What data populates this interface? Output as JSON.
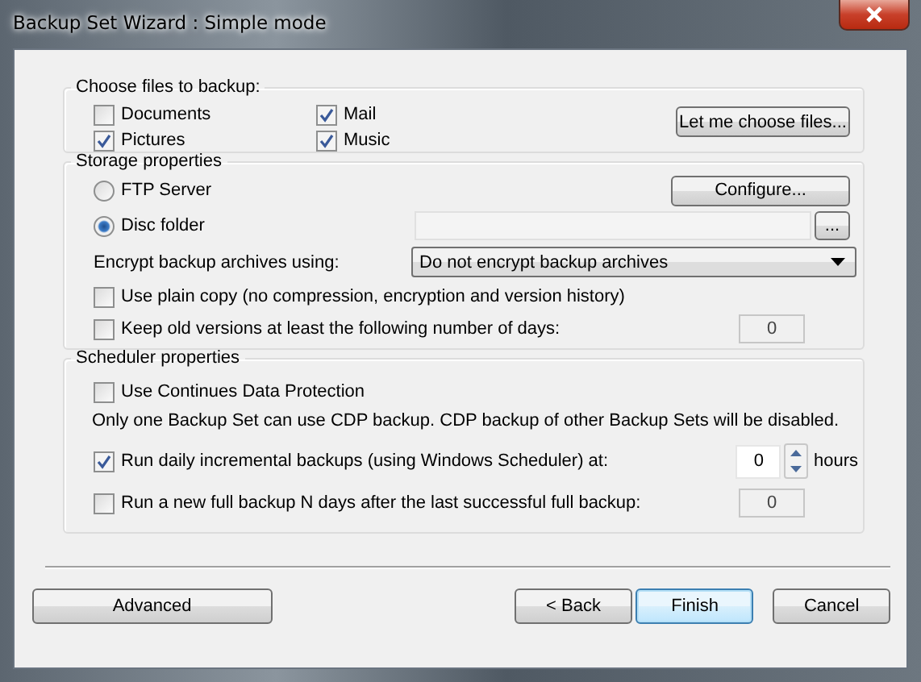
{
  "window": {
    "title": "Backup Set Wizard : Simple mode"
  },
  "files_group": {
    "title": "Choose files to backup:",
    "options": [
      {
        "label": "Documents",
        "checked": false
      },
      {
        "label": "Pictures",
        "checked": true
      },
      {
        "label": "Mail",
        "checked": true
      },
      {
        "label": "Music",
        "checked": true
      }
    ],
    "choose_button": "Let me choose files..."
  },
  "storage_group": {
    "title": "Storage properties",
    "destinations": [
      {
        "label": "FTP Server",
        "selected": false
      },
      {
        "label": "Disc folder",
        "selected": true
      }
    ],
    "configure_button": "Configure...",
    "browse_button": "...",
    "encrypt_label": "Encrypt backup archives using:",
    "encrypt_value": "Do not encrypt backup archives",
    "options": [
      {
        "label": "Use plain copy (no compression, encryption and version history)",
        "checked": false
      },
      {
        "label": "Keep old versions at least the following number of days:",
        "checked": false,
        "value": "0"
      }
    ]
  },
  "scheduler_group": {
    "title": "Scheduler properties",
    "cdp": {
      "label": "Use Continues Data Protection",
      "checked": false
    },
    "note": "Only one Backup Set can use CDP backup. CDP backup of other Backup Sets will be disabled.",
    "options": [
      {
        "kind": "spinner",
        "label": "Run daily incremental backups (using Windows Scheduler) at:",
        "checked": true,
        "value": "0",
        "unit": "hours"
      },
      {
        "kind": "field",
        "label": "Run a new full backup N days after the last successful full backup:",
        "checked": false,
        "value": "0"
      }
    ]
  },
  "buttons": [
    {
      "label": "Advanced",
      "default": false
    },
    {
      "label": "< Back",
      "default": false
    },
    {
      "label": "Finish",
      "default": true
    },
    {
      "label": "Cancel",
      "default": false
    }
  ]
}
